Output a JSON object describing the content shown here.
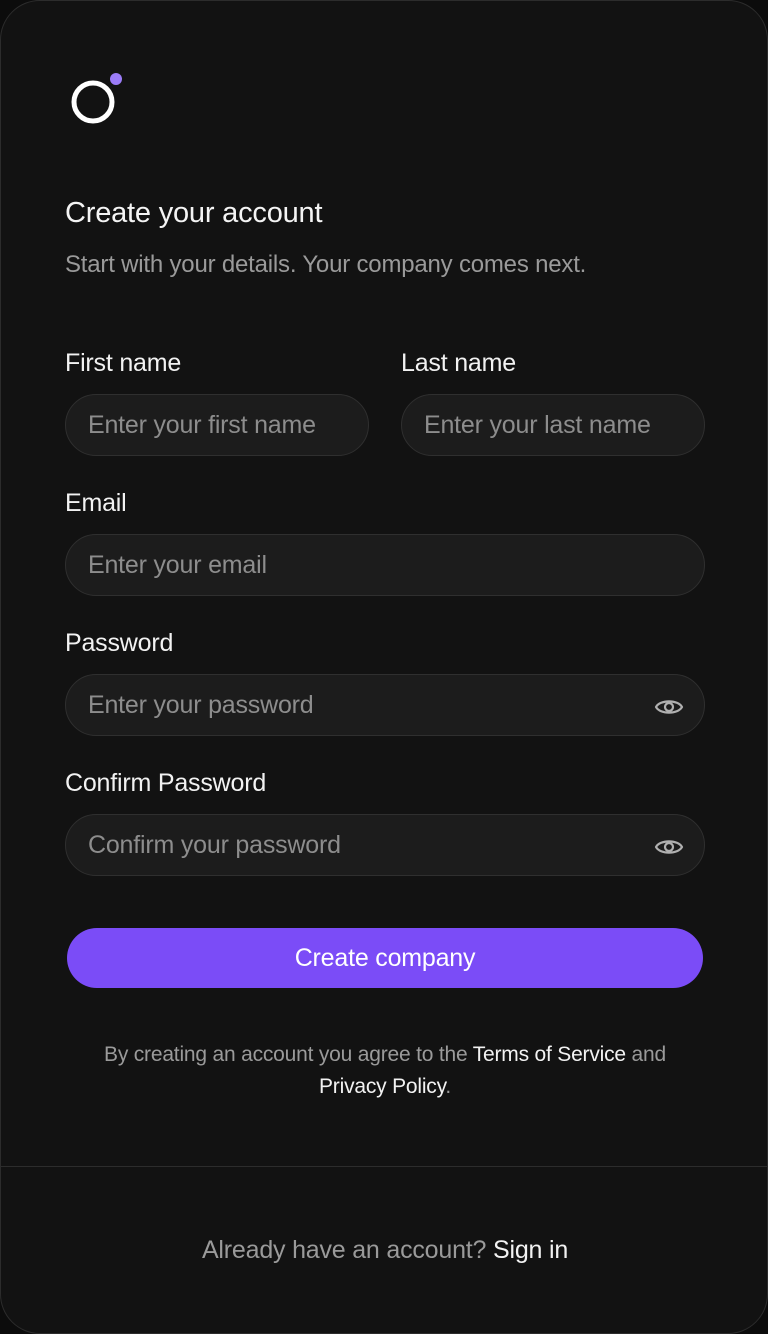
{
  "brand": {
    "logo_icon": "ring-logo-icon",
    "accent_color": "#7b4cf7",
    "dot_color": "#9b7cf7"
  },
  "header": {
    "title": "Create your account",
    "subtitle": "Start with your details. Your company comes next."
  },
  "form": {
    "first_name": {
      "label": "First name",
      "placeholder": "Enter your first name",
      "value": ""
    },
    "last_name": {
      "label": "Last name",
      "placeholder": "Enter your last name",
      "value": ""
    },
    "email": {
      "label": "Email",
      "placeholder": "Enter your email",
      "value": ""
    },
    "password": {
      "label": "Password",
      "placeholder": "Enter your password",
      "value": "",
      "toggle_icon": "eye-icon"
    },
    "confirm_password": {
      "label": "Confirm Password",
      "placeholder": "Confirm your password",
      "value": "",
      "toggle_icon": "eye-icon"
    },
    "submit_label": "Create company"
  },
  "terms": {
    "prefix": "By creating an account you agree to the ",
    "terms_link": "Terms of Service",
    "middle": " and ",
    "privacy_link": "Privacy Policy",
    "suffix": "."
  },
  "footer": {
    "prompt": "Already have an account? ",
    "sign_in_link": "Sign in"
  }
}
